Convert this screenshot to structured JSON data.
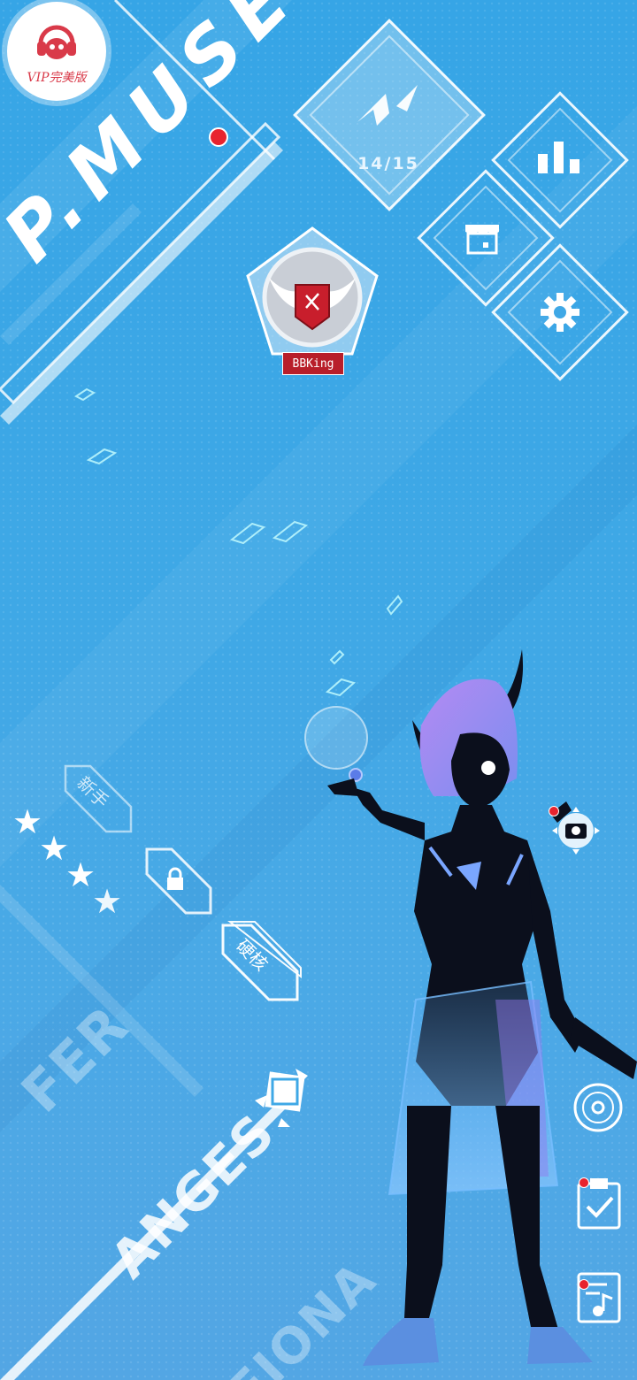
{
  "app": {
    "logo_text": "P.MUSE",
    "vip_label": "VIP完美版"
  },
  "top_menu": {
    "stamina_text": "14/15",
    "icons": [
      "lightning-icon",
      "chart-icon",
      "shop-icon",
      "gear-icon"
    ]
  },
  "player": {
    "name": "BBKing",
    "emblem": "winged-crest-badge"
  },
  "difficulty": {
    "easy_label": "新手",
    "locked_icon": "lock-icon",
    "hard_label": "硬核",
    "stars_shown": 4
  },
  "characters": {
    "names": [
      "FER",
      "ANGES",
      "FIONA"
    ]
  },
  "side_buttons": [
    "camera-icon",
    "disc-icon",
    "clipboard-check-icon",
    "music-sheet-icon"
  ],
  "colors": {
    "background": "#3fa8e6",
    "accent_red": "#e8232e",
    "badge_red": "#b81e2a",
    "white": "#ffffff"
  }
}
